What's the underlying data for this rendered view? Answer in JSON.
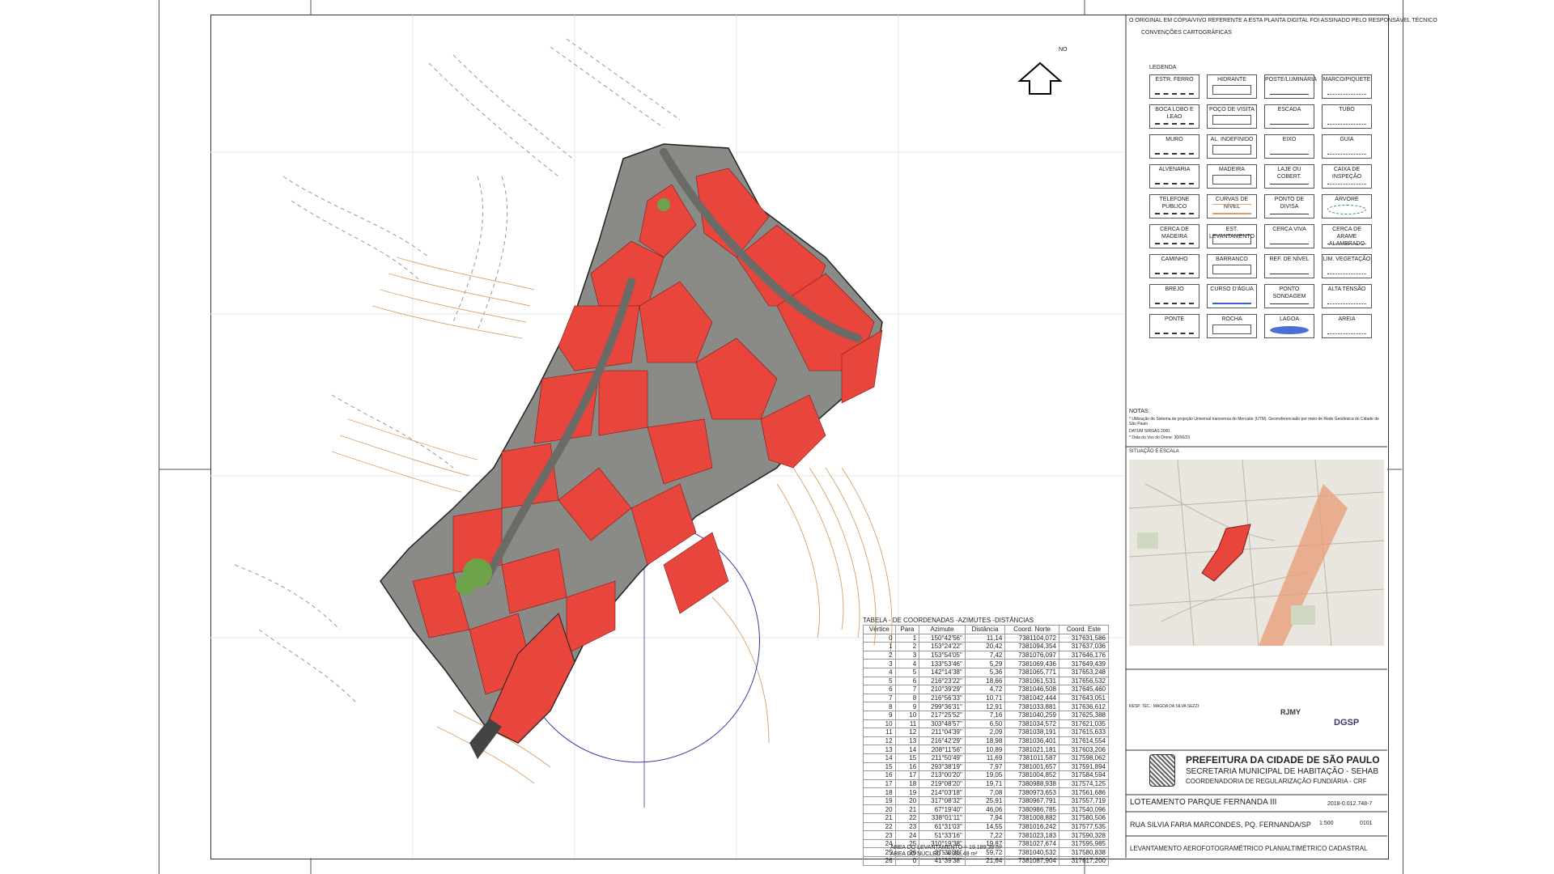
{
  "north": {
    "label": "NO"
  },
  "header_note": "O ORIGINAL EM CÓPIA/VIVO REFERENTE A ESTA PLANTA DIGITAL FOI ASSINADO PELO RESPONSÁVEL TÉCNICO",
  "legend": {
    "title": "CONVENÇÕES CARTOGRÁFICAS",
    "subtitle": "LEGENDA",
    "items": [
      "ESTR. FERRO",
      "HIDRANTE",
      "POSTE/LUMINÁRIA",
      "MARCO/PIQUETE",
      "BOCA LOBO E LEAO",
      "POÇO DE VISITA",
      "ESCADA",
      "TUBO",
      "MURO",
      "AL. INDEFINIDO",
      "EIXO",
      "GUIA",
      "ALVENARIA",
      "MADEIRA",
      "LAJE OU COBERT.",
      "CAIXA DE INSPEÇÃO",
      "TELEFONE PÚBLICO",
      "CURVAS DE NÍVEL",
      "PONTO DE DIVISA",
      "ÁRVORE",
      "CERCA DE MADEIRA",
      "EST. LEVANTAMENTO",
      "CERCA VIVA",
      "CERCA DE ARAME ALAMBRADO",
      "CAMINHO",
      "BARRANCO",
      "REF. DE NÍVEL",
      "LIM. VEGETAÇÃO",
      "BREJO",
      "CURSO D'ÁGUA",
      "PONTO SONDAGEM",
      "ALTA TENSÃO",
      "PONTE",
      "ROCHA",
      "LAGOA",
      "AREIA"
    ]
  },
  "notes": {
    "title": "NOTAS:",
    "line1": "* Utilização do Sistema de projeção Universal transversa de Mercator (UTM). Georreferenciado por meio de Rede Geodésica do Cidade de São Paulo",
    "line2": "DATUM SIRGAS 2000.",
    "line3": "* Data do Voo do Drone: 30/06/23"
  },
  "location_title": "SITUAÇÃO E ESCALA",
  "table": {
    "title": "TABELA - DE COORDENADAS -AZIMUTES -DISTÂNCIAS",
    "headers": [
      "Vértice",
      "Para",
      "Azimute",
      "Distância",
      "Coord. Norte",
      "Coord. Este"
    ],
    "rows": [
      [
        "0",
        "1",
        "150°42'56\"",
        "11,14",
        "7381104,072",
        "317631,586"
      ],
      [
        "1",
        "2",
        "153°24'22\"",
        "20,42",
        "7381094,354",
        "317637,036"
      ],
      [
        "2",
        "3",
        "153°54'05\"",
        "7,42",
        "7381076,097",
        "317646,176"
      ],
      [
        "3",
        "4",
        "133°53'46\"",
        "5,29",
        "7381069,436",
        "317649,439"
      ],
      [
        "4",
        "5",
        "142°14'38\"",
        "5,36",
        "7381065,771",
        "317653,248"
      ],
      [
        "5",
        "6",
        "216°23'22\"",
        "18,66",
        "7381061,531",
        "317656,532"
      ],
      [
        "6",
        "7",
        "210°39'29\"",
        "4,72",
        "7381046,508",
        "317645,460"
      ],
      [
        "7",
        "8",
        "216°56'33\"",
        "10,71",
        "7381042,444",
        "317643,051"
      ],
      [
        "8",
        "9",
        "299°36'31\"",
        "12,91",
        "7381033,881",
        "317636,612"
      ],
      [
        "9",
        "10",
        "217°25'52\"",
        "7,16",
        "7381040,259",
        "317625,388"
      ],
      [
        "10",
        "11",
        "303°48'57\"",
        "6,50",
        "7381034,572",
        "317621,035"
      ],
      [
        "11",
        "12",
        "211°04'39\"",
        "2,09",
        "7381038,191",
        "317615,633"
      ],
      [
        "12",
        "13",
        "216°42'29\"",
        "18,98",
        "7381036,401",
        "317614,554"
      ],
      [
        "13",
        "14",
        "208°11'56\"",
        "10,89",
        "7381021,181",
        "317603,206"
      ],
      [
        "14",
        "15",
        "211°50'49\"",
        "11,69",
        "7381011,587",
        "317598,062"
      ],
      [
        "15",
        "16",
        "293°38'19\"",
        "7,97",
        "7381001,657",
        "317591,894"
      ],
      [
        "16",
        "17",
        "213°00'20\"",
        "19,05",
        "7381004,852",
        "317584,594"
      ],
      [
        "17",
        "18",
        "219°08'20\"",
        "19,71",
        "7380988,938",
        "317574,125"
      ],
      [
        "18",
        "19",
        "214°03'18\"",
        "7,08",
        "7380973,653",
        "317561,686"
      ],
      [
        "19",
        "20",
        "317°08'32\"",
        "25,91",
        "7380967,791",
        "317557,719"
      ],
      [
        "20",
        "21",
        "67°19'40\"",
        "46,06",
        "7380986,785",
        "317540,096"
      ],
      [
        "21",
        "22",
        "338°01'11\"",
        "7,94",
        "7381008,882",
        "317580,506"
      ],
      [
        "22",
        "23",
        "61°31'03\"",
        "14,55",
        "7381016,242",
        "317577,535"
      ],
      [
        "23",
        "24",
        "51°33'16\"",
        "7,22",
        "7381023,183",
        "317590,328"
      ],
      [
        "24",
        "25",
        "310°19'38\"",
        "19,87",
        "7381027,674",
        "317595,985"
      ],
      [
        "25",
        "26",
        "37°30'35\"",
        "59,72",
        "7381040,532",
        "317580,838"
      ],
      [
        "26",
        "0",
        "41°39'38\"",
        "21,64",
        "7381087,904",
        "317617,200"
      ]
    ],
    "area_survey": "ÁREA DO LEVANTAMENTO = 19.189,38 m²",
    "area_core": "ÁREA DO NÚCLEO = 4.033,48 m²"
  },
  "title_block": {
    "city": "PREFEITURA DA CIDADE DE SÃO PAULO",
    "secretariat": "SECRETARIA MUNICIPAL DE HABITAÇÃO - SEHAB",
    "coord": "COORDENADORIA DE REGULARIZAÇÃO FUNDIÁRIA - CRF",
    "project": "LOTEAMENTO PARQUE FERNANDA III",
    "process": "2018-0.012.748-7",
    "address": "RUA SILVIA FARIA MARCONDES, PQ. FERNANDA/SP",
    "scale": "1:500",
    "sheet": "0101",
    "drawing": "LEVANTAMENTO AEROFOTOGRAMÉTRICO PLANIALTIMÉTRICO CADASTRAL",
    "logo1": "DGSP",
    "logo2": "RJMY",
    "resp_label": "RESP. TÉC.: MAGDA DA SILVA SEZZI"
  },
  "colors": {
    "building": "#e8453c",
    "contour": "#d9a066",
    "block_outline": "#222"
  }
}
